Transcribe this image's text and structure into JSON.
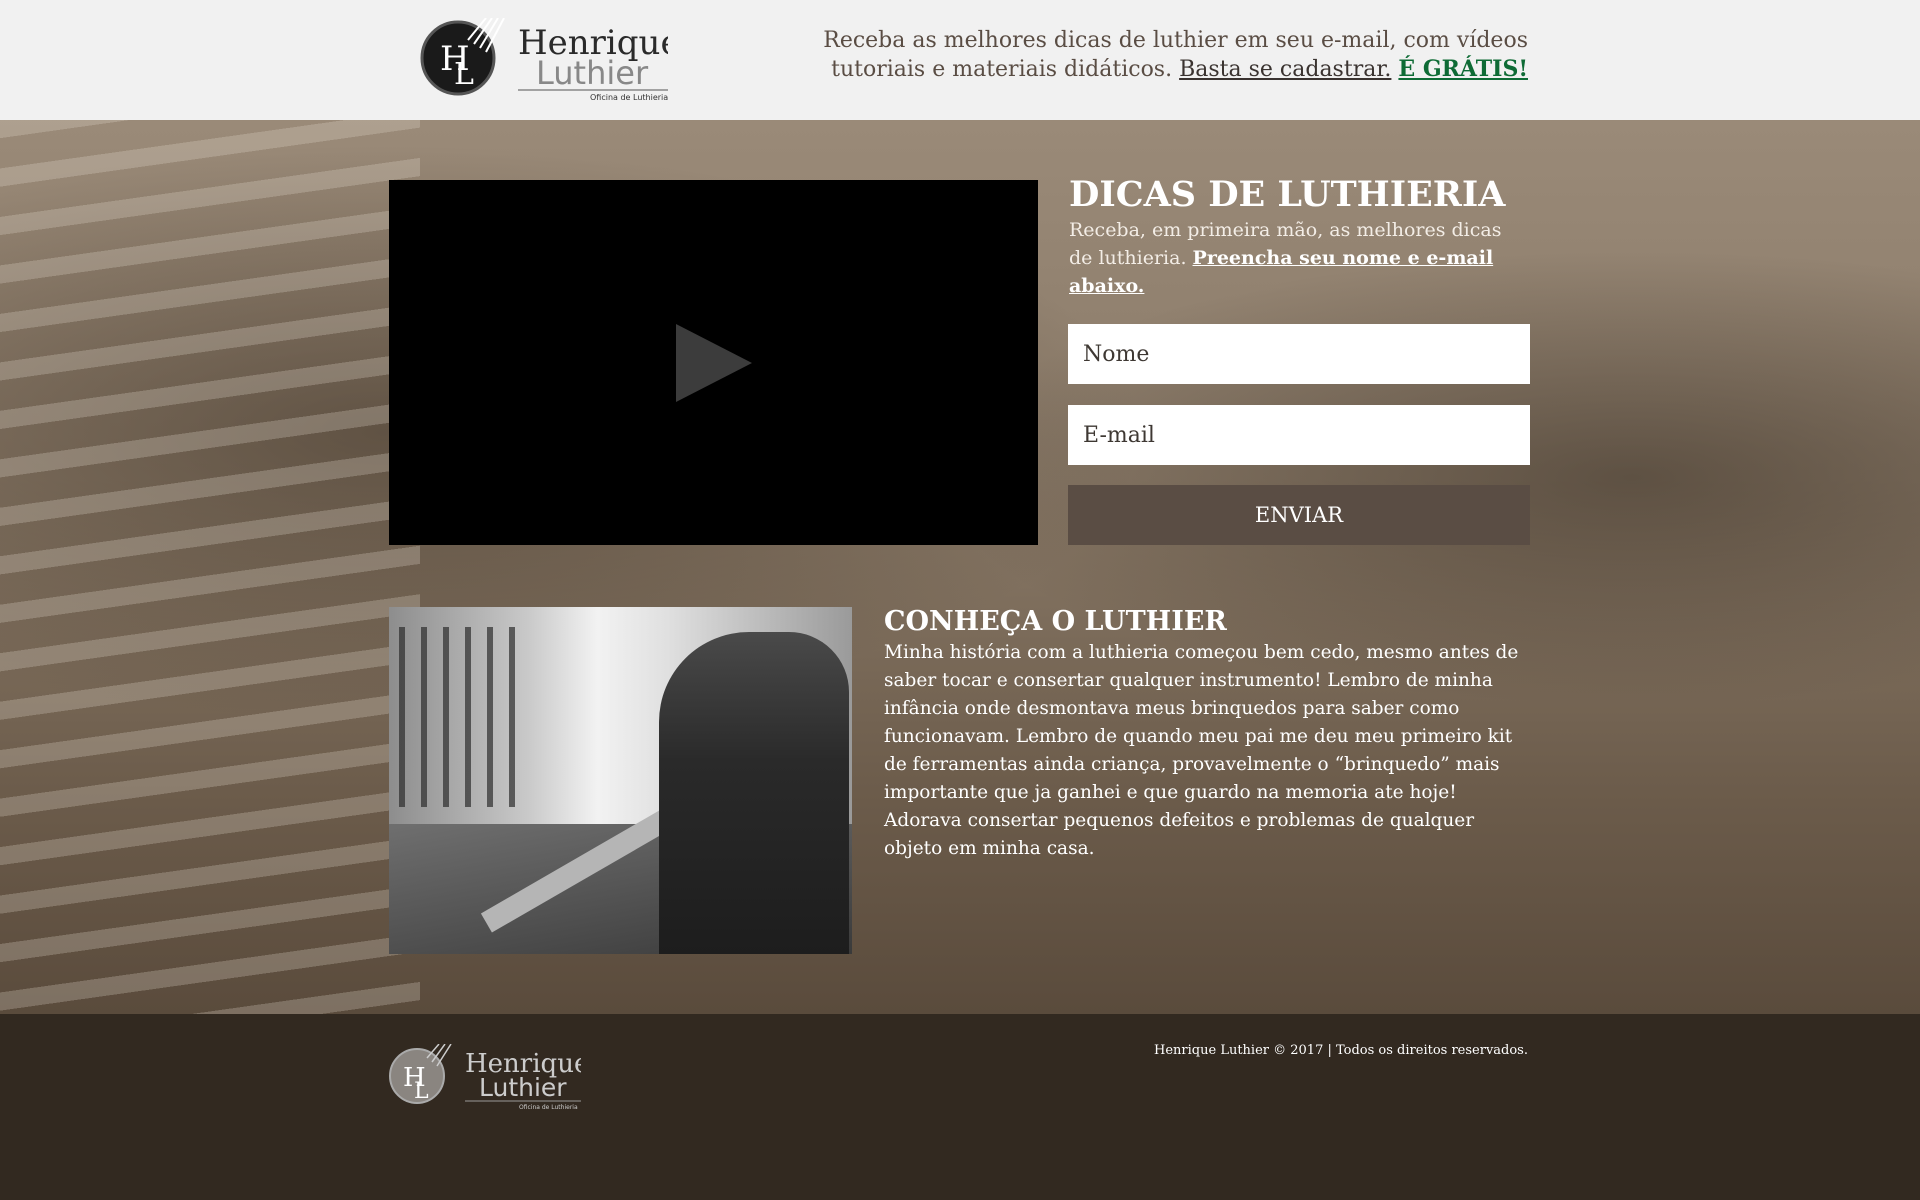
{
  "header": {
    "logo_text": "Henrique Luthier",
    "logo_tagline": "Oficina de Luthieria",
    "promo_text": "Receba as melhores dicas de luthier em seu e-mail, com vídeos tutoriais e materiais didáticos.",
    "signup_link": "Basta se cadastrar.",
    "free_link": "É GRÁTIS!"
  },
  "signup": {
    "title": "DICAS DE LUTHIERIA",
    "subtitle": "Receba, em primeira mão, as melhores dicas de luthieria.",
    "subtitle_link": "Preencha seu nome e e-mail abaixo.",
    "name_placeholder": "Nome",
    "email_placeholder": "E-mail",
    "submit_label": "ENVIAR"
  },
  "video": {
    "icon": "play-icon"
  },
  "about": {
    "title": "CONHEÇA O LUTHIER",
    "text": "Minha história com a luthieria começou bem cedo, mesmo antes de saber tocar e consertar qualquer instrumento! Lembro de minha infância onde desmontava meus brinquedos para saber como funcionavam. Lembro de quando meu pai me deu meu primeiro kit de ferramentas ainda criança, provavelmente o “brinquedo” mais importante que ja ganhei e que guardo na memoria ate hoje! Adorava consertar pequenos defeitos e problemas de qualquer objeto em minha casa."
  },
  "footer": {
    "copyright": "Henrique Luthier © 2017  | Todos os direitos reservados."
  },
  "colors": {
    "accent_green": "#0e6b35",
    "button": "#5a4d44",
    "footer_bg": "#322920"
  }
}
